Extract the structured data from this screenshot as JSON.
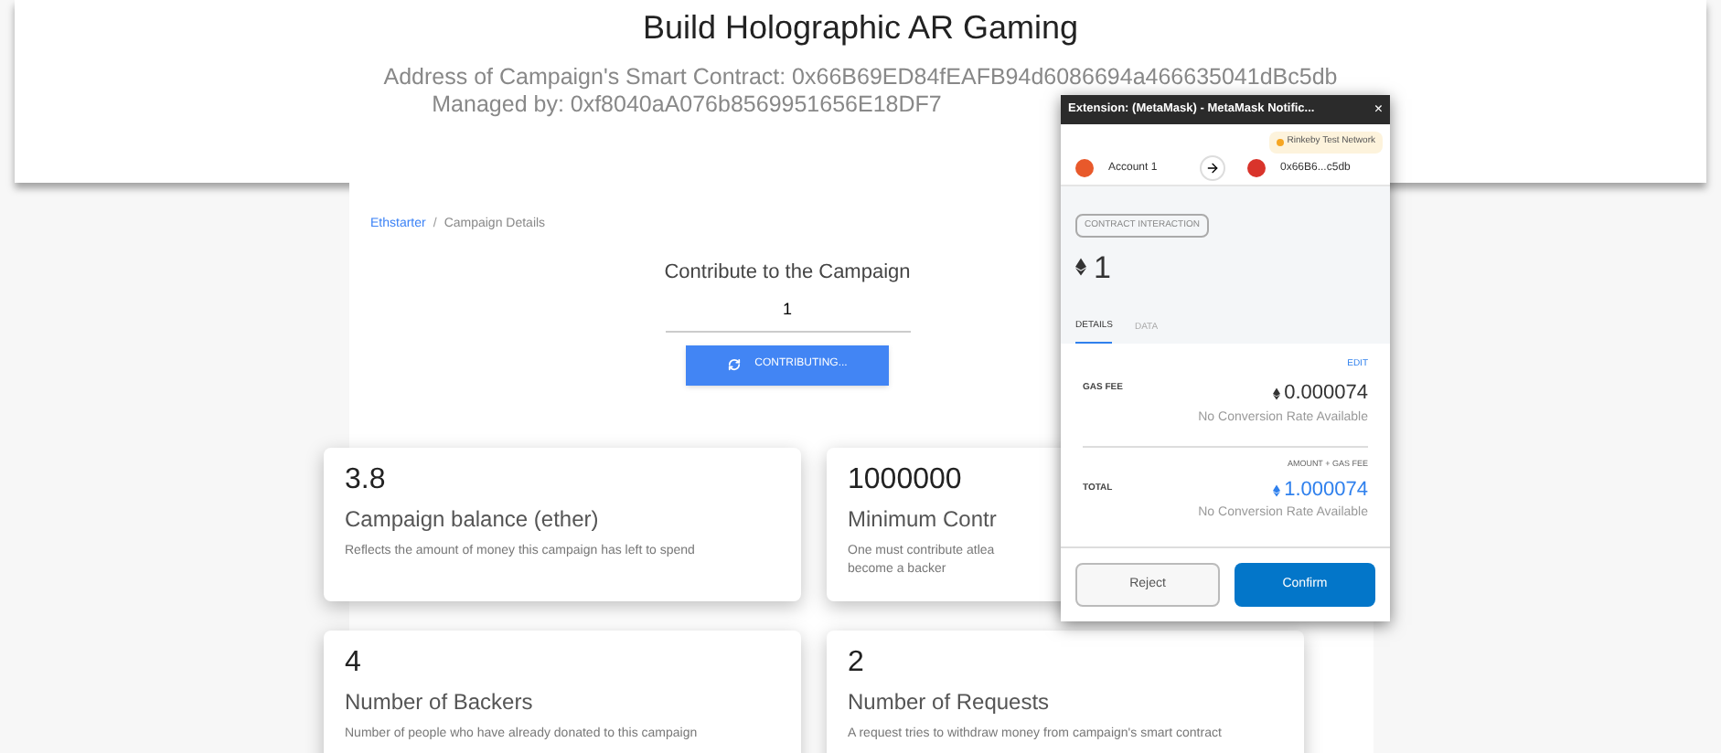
{
  "header": {
    "title": "Build Holographic AR Gaming",
    "address": "Address of Campaign's Smart Contract: 0x66B69ED84fEAFB94d6086694a466635041dBc5db",
    "manager": "Managed by: 0xf8040aA076b8569951656E18DF7"
  },
  "breadcrumb": [
    {
      "label": "Ethstarter",
      "link": true
    },
    {
      "label": "Campaign Details",
      "link": false
    }
  ],
  "breadcrumb_separator": "/",
  "contribute": {
    "title": "Contribute to the Campaign",
    "value": "1",
    "button": "CONTRIBUTING...",
    "loading": true
  },
  "cards": [
    {
      "value": "3.8",
      "title": "Campaign balance (ether)",
      "description": "Reflects the amount of money this campaign has left to spend"
    },
    {
      "value": "1000000",
      "title": "Minimum Contr",
      "description": "One must contribute atlea become a backer"
    },
    {
      "value": "4",
      "title": "Number of Backers",
      "description": "Number of people who have already donated to this campaign"
    },
    {
      "value": "2",
      "title": "Number of Requests",
      "description": "A request tries to withdraw money from campaign's smart contract"
    }
  ],
  "popup": {
    "title": "Extension: (MetaMask) - MetaMask Notific...",
    "close": "×",
    "network": "Rinkeby Test Network",
    "from": "Account 1",
    "to": "0x66B6...c5db",
    "badge": "CONTRACT INTERACTION",
    "amount": "1",
    "tabs": [
      {
        "label": "DETAILS",
        "selected": true
      },
      {
        "label": "DATA",
        "selected": false
      }
    ],
    "edit": "EDIT",
    "gas_label": "GAS FEE",
    "gas": "0.000074",
    "gas_note": "No Conversion Rate Available",
    "total_caption": "AMOUNT + GAS FEE",
    "total_label": "TOTAL",
    "total": "1.000074",
    "total_note": "No Conversion Rate Available",
    "reject": "Reject",
    "confirm": "Confirm"
  }
}
